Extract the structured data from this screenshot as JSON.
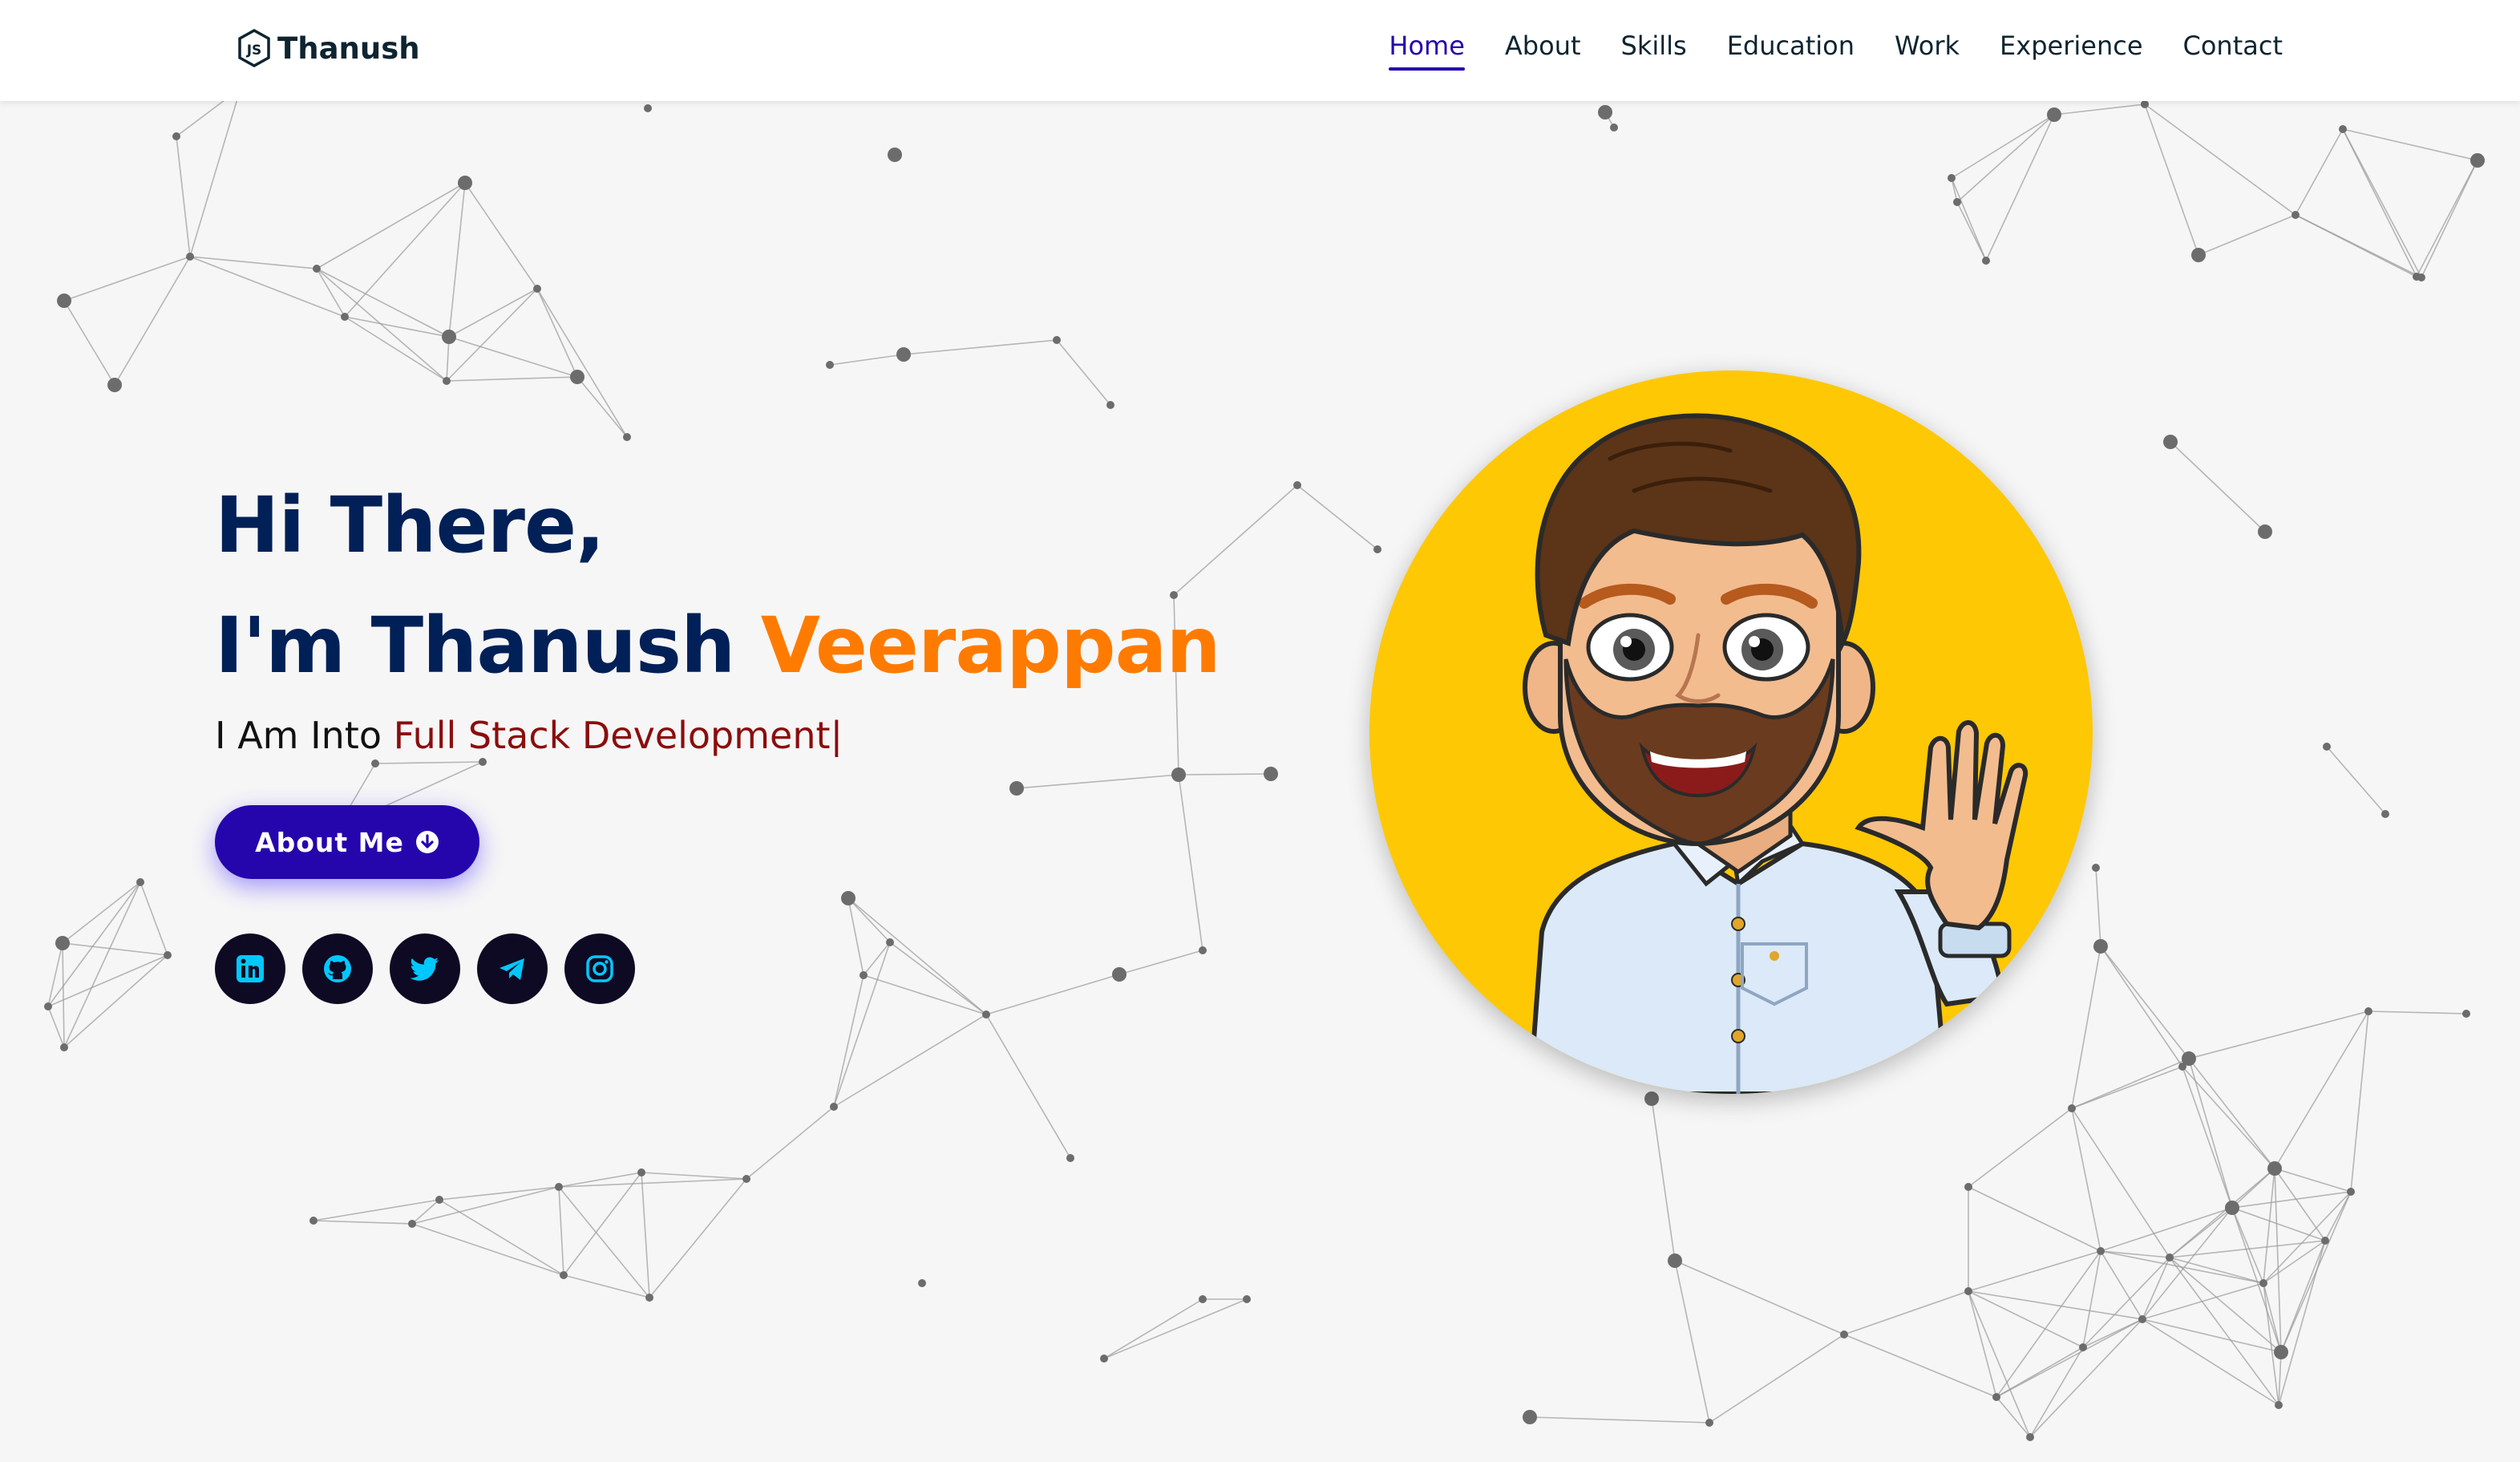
{
  "brand": {
    "name": "Thanush",
    "icon": "js-logo-icon"
  },
  "nav": {
    "active": "Home",
    "items": [
      {
        "label": "Home"
      },
      {
        "label": "About"
      },
      {
        "label": "Skills"
      },
      {
        "label": "Education"
      },
      {
        "label": "Work"
      },
      {
        "label": "Experience"
      },
      {
        "label": "Contact"
      }
    ]
  },
  "hero": {
    "line1": "Hi There,",
    "line2_prefix": "I'm Thanush ",
    "line2_accent": "Veerappan",
    "typing_prefix": "I Am Into ",
    "typing_value": "Full Stack Development",
    "typing_cursor": "|",
    "button_label": "About Me",
    "button_icon": "arrow-down-circle-icon"
  },
  "socials": [
    {
      "name": "linkedin",
      "icon": "linkedin-icon"
    },
    {
      "name": "github",
      "icon": "github-icon"
    },
    {
      "name": "twitter",
      "icon": "twitter-icon"
    },
    {
      "name": "telegram",
      "icon": "telegram-icon"
    },
    {
      "name": "instagram",
      "icon": "instagram-icon"
    }
  ],
  "avatar": {
    "icon": "cartoon-avatar-waving"
  },
  "colors": {
    "primary": "#2506ad",
    "heading": "#002057",
    "accent": "#ff7b00",
    "typed": "#8b0d0d",
    "avatar_bg": "#ffc804",
    "social_bg": "#0e0a24",
    "social_icon": "#00c8ff"
  }
}
